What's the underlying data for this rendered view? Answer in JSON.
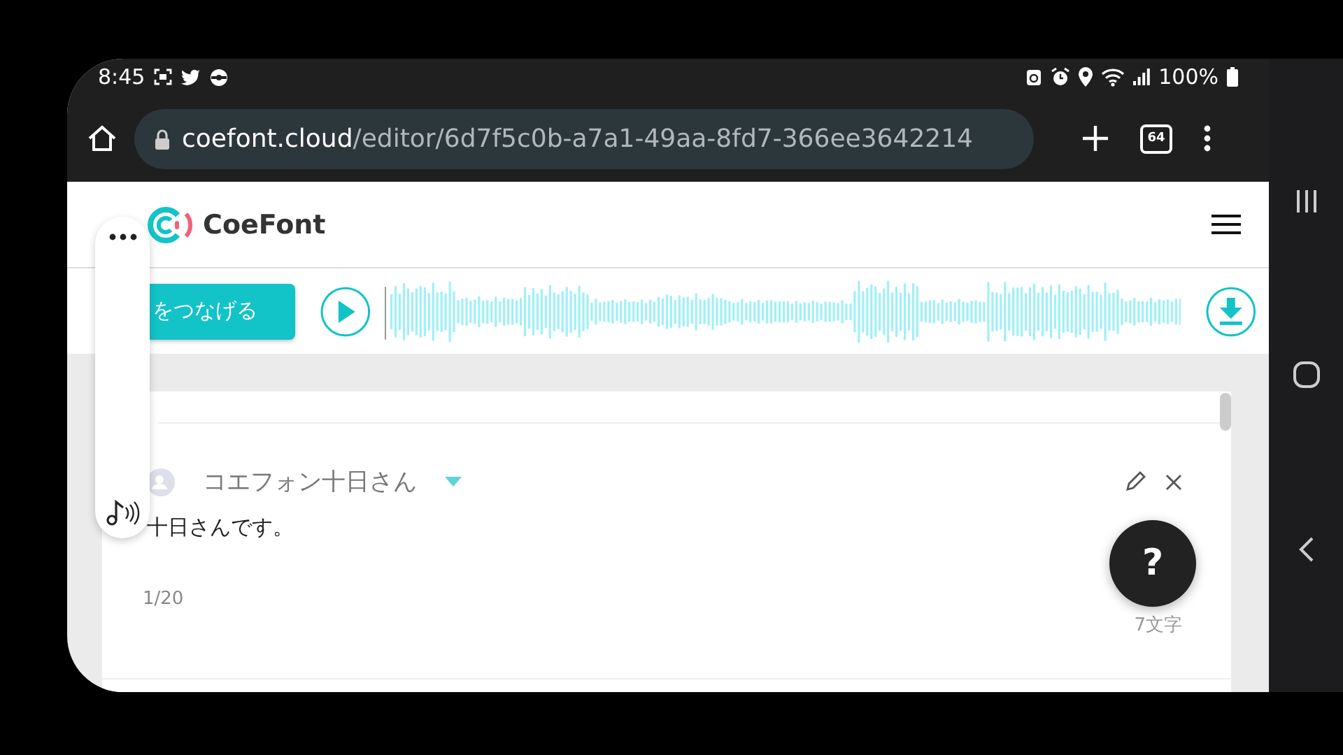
{
  "status_bar": {
    "time": "8:45",
    "battery": "100%"
  },
  "browser": {
    "url_host": "coefont.cloud",
    "url_path": "/editor/6d7f5c0b-a7a1-49aa-8fd7-366ee3642214",
    "tab_count": "64"
  },
  "app": {
    "brand": "CoeFont"
  },
  "toolbar": {
    "connect_button": "をつなげる"
  },
  "editor": {
    "blocks": [
      {
        "speaker": "コエフォン十日さん",
        "text": "十日さんです。",
        "index": "1/20",
        "char_count": "7文字"
      }
    ]
  },
  "help_button": "?"
}
